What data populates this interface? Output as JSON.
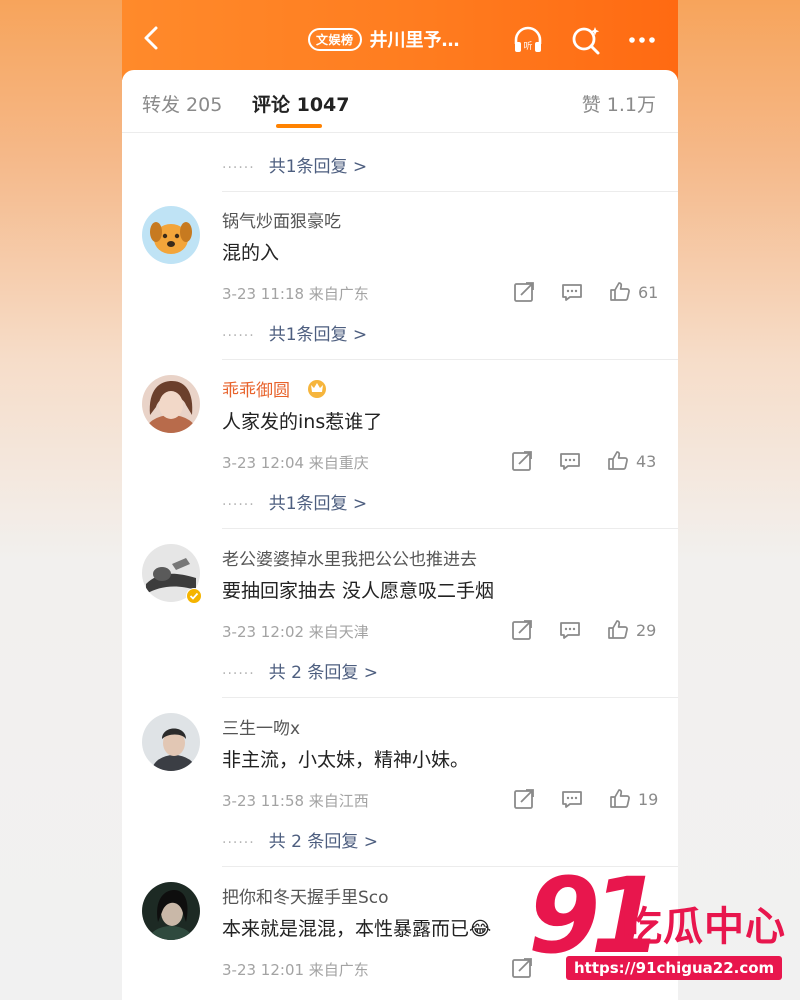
{
  "header": {
    "rank_badge": "文娱榜",
    "title": "井川里予…"
  },
  "tabs": {
    "reposts": "转发 205",
    "comments": "评论 1047",
    "likes": "赞 1.1万"
  },
  "top_reply_link": "共1条回复 >",
  "comments": [
    {
      "username": "锅气炒面狠豪吃",
      "text": "混的入",
      "meta": "3-23 11:18  来自广东",
      "likes": "61",
      "replies": "共1条回复 >"
    },
    {
      "username": "乖乖御圆",
      "text": "人家发的ins惹谁了",
      "meta": "3-23 12:04  来自重庆",
      "likes": "43",
      "replies": "共1条回复 >"
    },
    {
      "username": "老公婆婆掉水里我把公公也推进去",
      "text": "要抽回家抽去 没人愿意吸二手烟",
      "meta": "3-23 12:02  来自天津",
      "likes": "29",
      "replies": "共 2 条回复 >"
    },
    {
      "username": "三生一吻x",
      "text": "非主流，小太妹，精神小妹。",
      "meta": "3-23 11:58  来自江西",
      "likes": "19",
      "replies": "共 2 条回复 >"
    },
    {
      "username": "把你和冬天握手里Sco",
      "text": "本来就是混混，本性暴露而已😂",
      "meta": "3-23 12:01  来自广东",
      "likes": "",
      "replies": ""
    }
  ],
  "watermark": {
    "number": "91",
    "name": "吃瓜中心",
    "url": "https://91chigua22.com"
  },
  "colors": {
    "brand_orange": "#ff7c1f",
    "link_blue": "#4d5e7f",
    "tab_indicator": "#ff8200",
    "vip_name": "#e8632c",
    "watermark_red": "#e8164d"
  }
}
